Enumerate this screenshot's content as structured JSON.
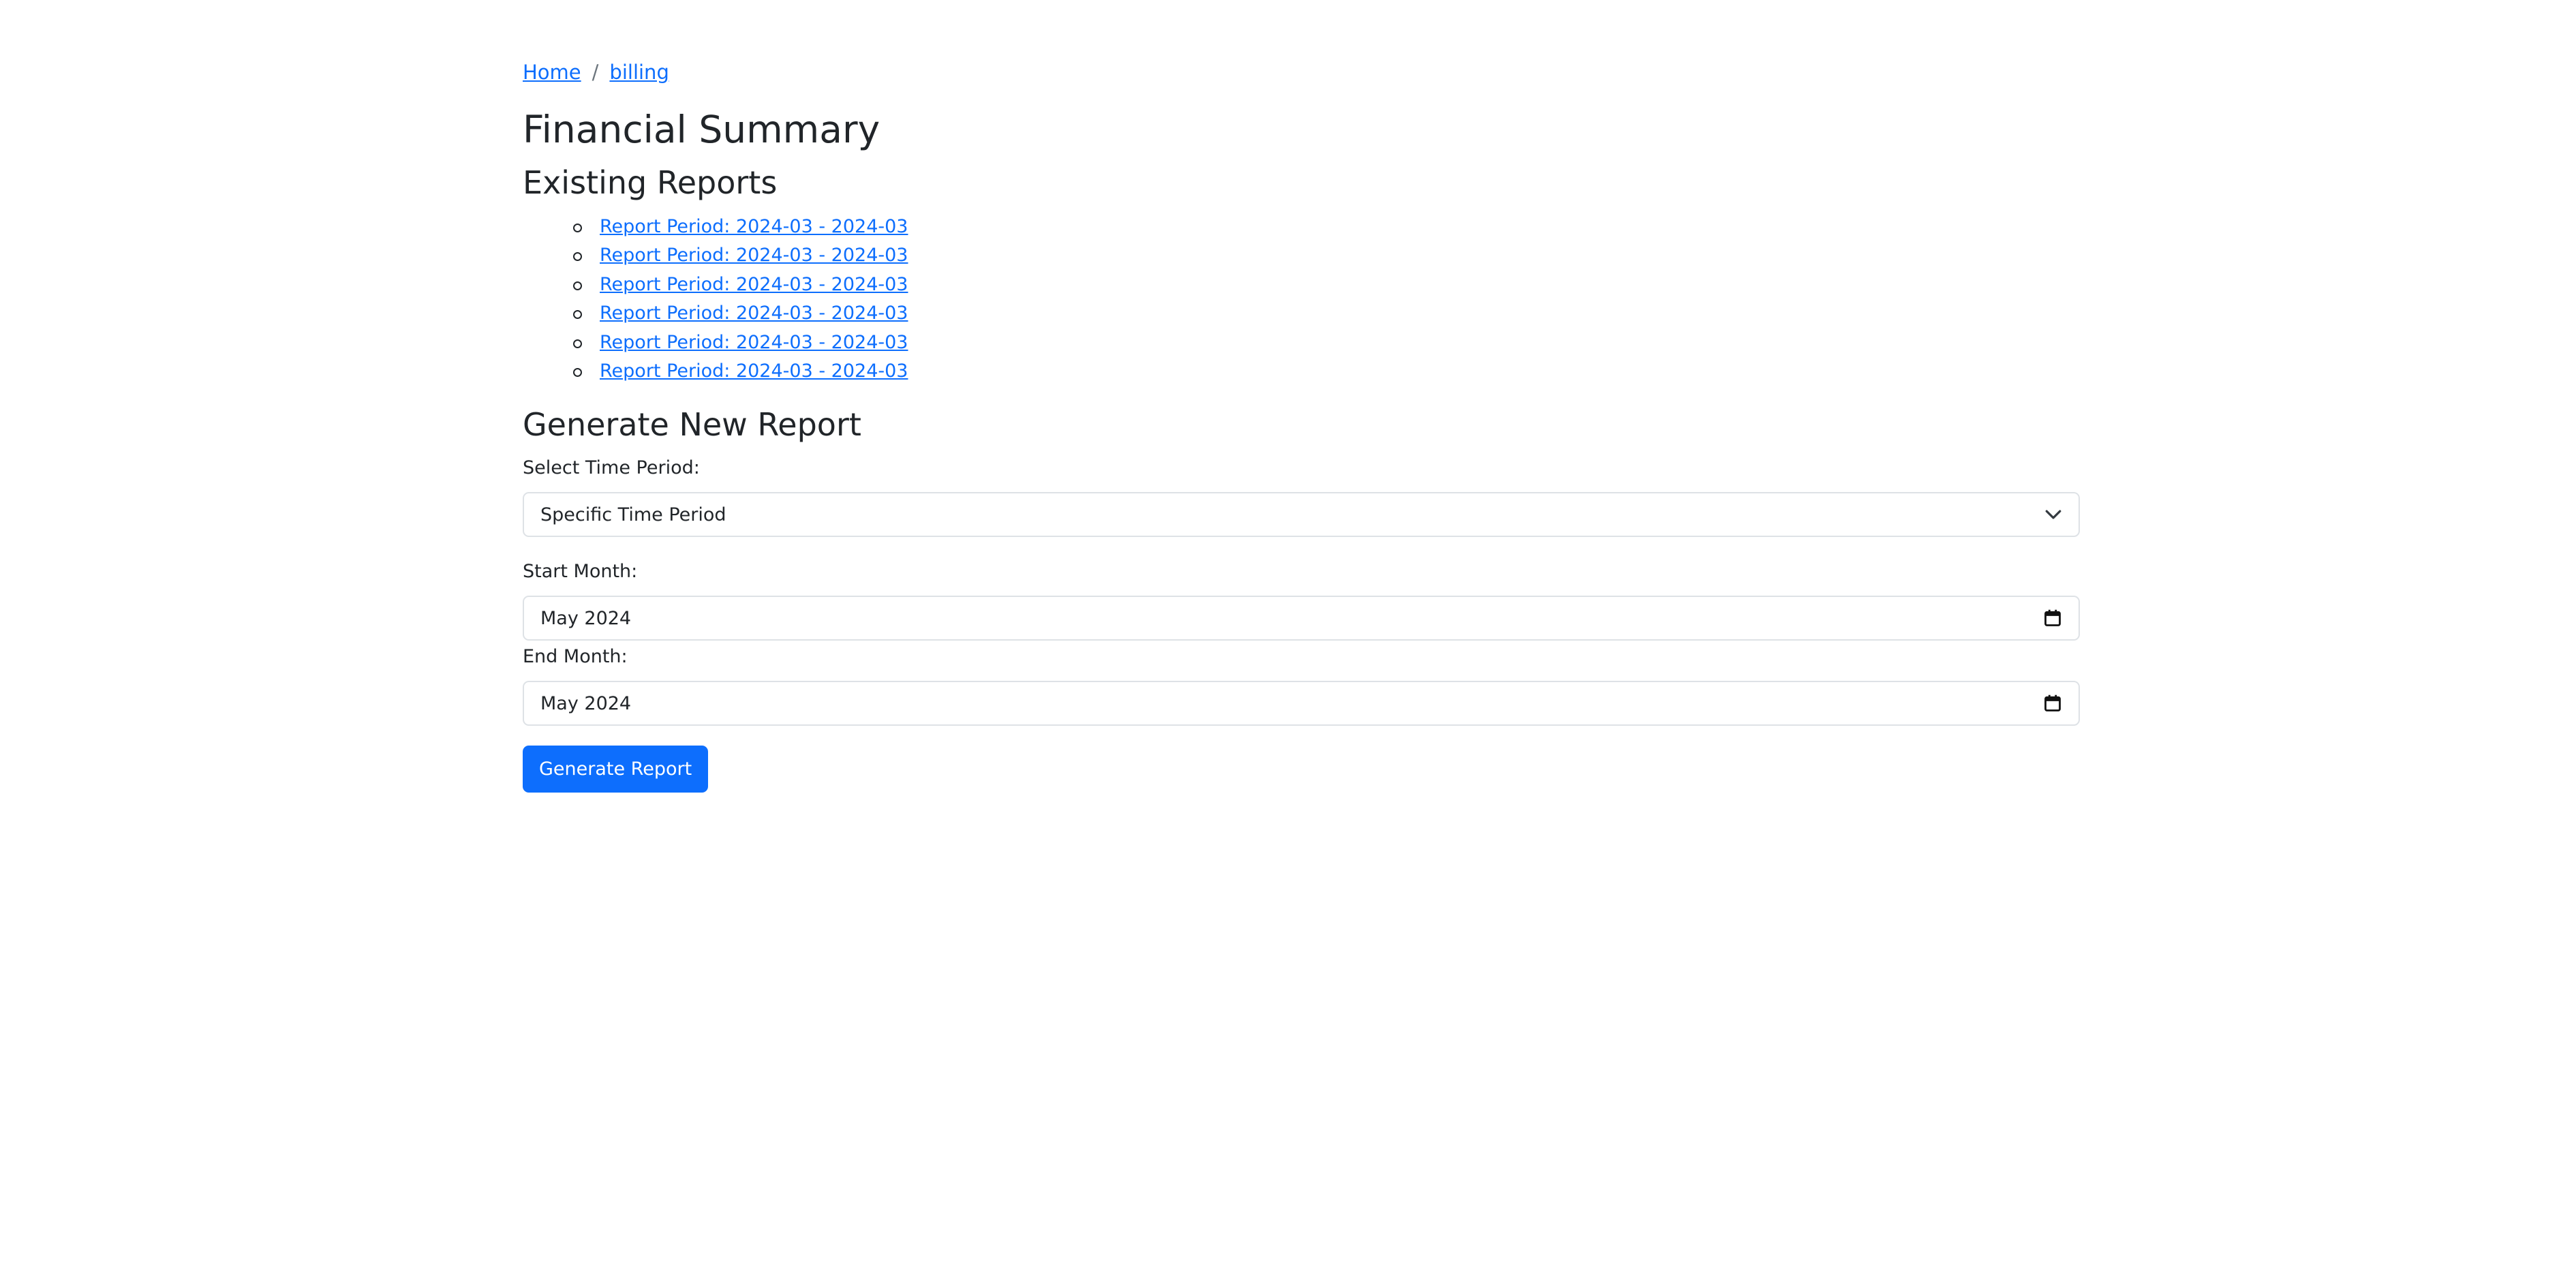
{
  "breadcrumb": {
    "home": "Home",
    "separator": "/",
    "current": "billing"
  },
  "page_title": "Financial Summary",
  "reports": {
    "title": "Existing Reports",
    "items": [
      "Report Period: 2024-03 - 2024-03",
      "Report Period: 2024-03 - 2024-03",
      "Report Period: 2024-03 - 2024-03",
      "Report Period: 2024-03 - 2024-03",
      "Report Period: 2024-03 - 2024-03",
      "Report Period: 2024-03 - 2024-03"
    ]
  },
  "generate": {
    "title": "Generate New Report",
    "time_period_label": "Select Time Period:",
    "time_period_value": "Specific Time Period",
    "start_month_label": "Start Month:",
    "start_month_value": "May 2024",
    "end_month_label": "End Month:",
    "end_month_value": "May 2024",
    "button_label": "Generate Report"
  },
  "colors": {
    "link": "#0d6efd",
    "button_bg": "#0d6efd",
    "text": "#212529",
    "border": "#dee2e6"
  },
  "icons": {
    "select": "chevron-down-icon",
    "date": "calendar-icon"
  }
}
